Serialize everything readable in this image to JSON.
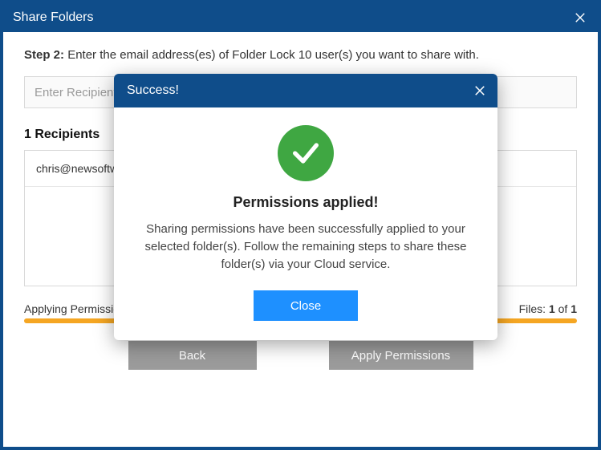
{
  "window": {
    "title": "Share Folders"
  },
  "step": {
    "label": "Step 2:",
    "text": "Enter the email address(es) of Folder Lock 10 user(s) you want to share with."
  },
  "input": {
    "placeholder": "Enter Recipient's Email"
  },
  "recipients": {
    "header": "1 Recipients",
    "items": [
      "chris@newsoftwares.net"
    ]
  },
  "status": {
    "left": "Applying Permissions . . .",
    "right_prefix": "Files: ",
    "current": "1",
    "of": " of ",
    "total": "1"
  },
  "buttons": {
    "back": "Back",
    "apply": "Apply Permissions"
  },
  "modal": {
    "header": "Success!",
    "title": "Permissions applied!",
    "text": "Sharing permissions have been successfully applied to your selected folder(s). Follow the remaining steps to share these folder(s) via your Cloud service.",
    "close": "Close"
  }
}
